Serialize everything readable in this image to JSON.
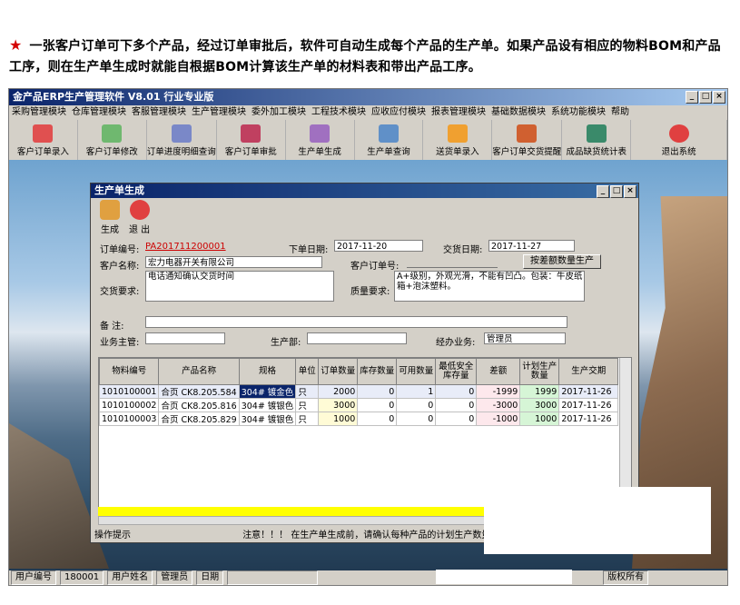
{
  "intro": {
    "text": "一张客户订单可下多个产品，经过订单审批后，软件可自动生成每个产品的生产单。如果产品设有相应的物料BOM和产品工序，则在生产单生成时就能自根据BOM计算该生产单的材料表和带出产品工序。"
  },
  "app": {
    "title": "金产品ERP生产管理软件  V8.01 行业专业版"
  },
  "menu": [
    "采购管理模块",
    "仓库管理模块",
    "客服管理模块",
    "生产管理模块",
    "委外加工模块",
    "工程技术模块",
    "应收应付模块",
    "报表管理模块",
    "基础数据模块",
    "系统功能模块",
    "帮助"
  ],
  "toolbar": [
    "客户订单录入",
    "客户订单修改",
    "订单进度明细查询",
    "客户订单审批",
    "生产单生成",
    "生产单查询",
    "送货单录入",
    "客户订单交货提醒",
    "成品缺货统计表",
    "退出系统"
  ],
  "dialog": {
    "title": "生产单生成",
    "btn_generate": "生成",
    "btn_exit": "退 出",
    "order_no_label": "订单编号:",
    "order_no": "PA201711200001",
    "order_date_label": "下单日期:",
    "order_date": "2017-11-20",
    "delivery_date_label": "交货日期:",
    "delivery_date": "2017-11-27",
    "customer_label": "客户名称:",
    "customer": "宏力电器开关有限公司",
    "cust_order_label": "客户订单号:",
    "gen_by_diff_btn": "按差额数量生产",
    "delivery_req_label": "交货要求:",
    "delivery_req": "电话通知确认交货时间",
    "quality_req_label": "质量要求:",
    "quality_req": "A+级别，外观光滑，不能有凹凸。包装：牛皮纸箱+泡沫塑料。",
    "remark_label": "备  注:",
    "supervisor_label": "业务主管:",
    "dept_label": "生产部:",
    "handler_label": "经办业务:",
    "handler": "管理员",
    "columns": [
      "物料编号",
      "产品名称",
      "规格",
      "单位",
      "订单数量",
      "库存数量",
      "可用数量",
      "最低安全库存量",
      "差额",
      "计划生产数量",
      "生产交期"
    ],
    "rows": [
      [
        "1010100001",
        "合页 CK8.205.584",
        "304# 镀金色",
        "只",
        "2000",
        "0",
        "1",
        "0",
        "-1999",
        "1999",
        "2017-11-26"
      ],
      [
        "1010100002",
        "合页 CK8.205.816",
        "304# 镀银色",
        "只",
        "3000",
        "0",
        "0",
        "0",
        "-3000",
        "3000",
        "2017-11-26"
      ],
      [
        "1010100003",
        "合页 CK8.205.829",
        "304# 镀银色",
        "只",
        "1000",
        "0",
        "0",
        "0",
        "-1000",
        "1000",
        "2017-11-26"
      ]
    ],
    "op_hint_label": "操作提示",
    "op_hint": "注意！！！  在生产单生成前，请确认每种产品的计划生产数量"
  },
  "status": {
    "user_no_label": "用户编号",
    "user_no": "180001",
    "user_name_label": "用户姓名",
    "user_name": "管理员",
    "date_label": "日期",
    "copyright": "版权所有"
  }
}
